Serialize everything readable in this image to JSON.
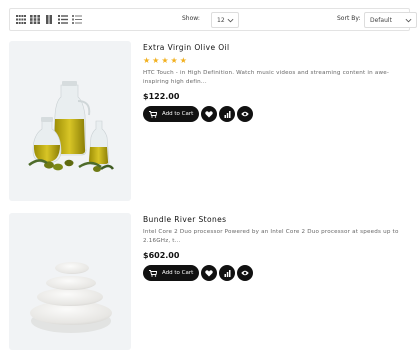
{
  "toolbar": {
    "show_label": "Show:",
    "show_value": "12",
    "sort_label": "Sort By:",
    "sort_value": "Default",
    "view_icons": [
      "grid-4-icon",
      "grid-3-icon",
      "grid-2-icon",
      "list-icon",
      "list-detail-icon"
    ]
  },
  "products": [
    {
      "title": "Extra Virgin Olive Oil",
      "rating": 5,
      "stars": "★★★★★",
      "description": "HTC Touch - in High Definition. Watch music videos and streaming content in awe-inspiring high defin...",
      "price": "$122.00",
      "cart_label": "Add to Cart"
    },
    {
      "title": "Bundle River Stones",
      "description": "Intel Core 2 Duo processor Powered by an Intel Core 2 Duo processor at speeds up to 2.16GHz, t...",
      "price": "$602.00",
      "cart_label": "Add to Cart"
    }
  ],
  "colors": {
    "accent": "#111111",
    "star": "#f2b01e",
    "image_bg": "#f1f3f5"
  }
}
